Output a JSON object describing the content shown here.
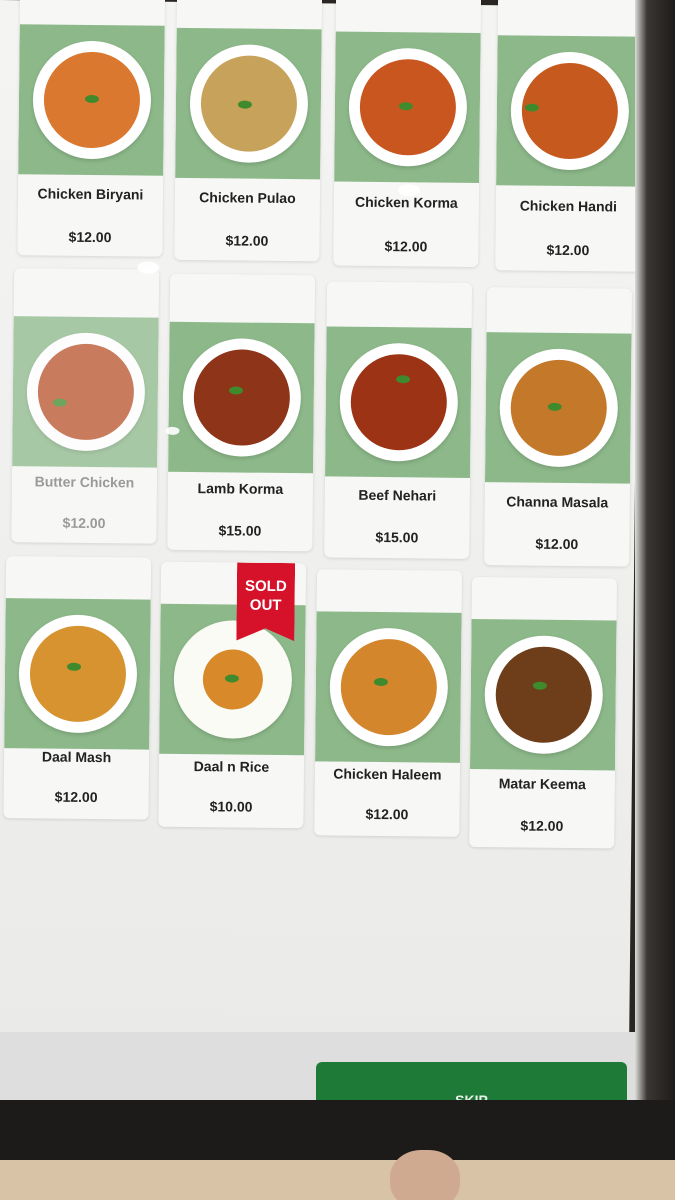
{
  "menu": {
    "items": [
      {
        "name": "Chicken Biryani",
        "price": "$12.00",
        "food_color": "#d9782e",
        "sold_out": false
      },
      {
        "name": "Chicken Pulao",
        "price": "$12.00",
        "food_color": "#c7a25a",
        "sold_out": false
      },
      {
        "name": "Chicken Korma",
        "price": "$12.00",
        "food_color": "#c9561f",
        "sold_out": false
      },
      {
        "name": "Chicken Handi",
        "price": "$12.00",
        "food_color": "#c65a1e",
        "sold_out": false
      },
      {
        "name": "Butter Chicken",
        "price": "$12.00",
        "food_color": "#b8532a",
        "sold_out": false
      },
      {
        "name": "Lamb Korma",
        "price": "$15.00",
        "food_color": "#8e3418",
        "sold_out": false
      },
      {
        "name": "Beef Nehari",
        "price": "$15.00",
        "food_color": "#9c3314",
        "sold_out": false
      },
      {
        "name": "Channa Masala",
        "price": "$12.00",
        "food_color": "#c4782a",
        "sold_out": false
      },
      {
        "name": "Daal Mash",
        "price": "$12.00",
        "food_color": "#d6932f",
        "sold_out": false
      },
      {
        "name": "Daal n Rice",
        "price": "$10.00",
        "food_color": "#d88a2a",
        "sold_out": true
      },
      {
        "name": "Chicken Haleem",
        "price": "$12.00",
        "food_color": "#d4862c",
        "sold_out": false
      },
      {
        "name": "Matar Keema",
        "price": "$12.00",
        "food_color": "#6e3d19",
        "sold_out": false
      }
    ],
    "sold_out_label_line1": "SOLD",
    "sold_out_label_line2": "OUT"
  },
  "actions": {
    "skip_label": "SKIP"
  },
  "colors": {
    "photo_bg": "#8db98a",
    "skip_bg": "#1d7a37",
    "sold_out_ribbon": "#d6112a"
  }
}
